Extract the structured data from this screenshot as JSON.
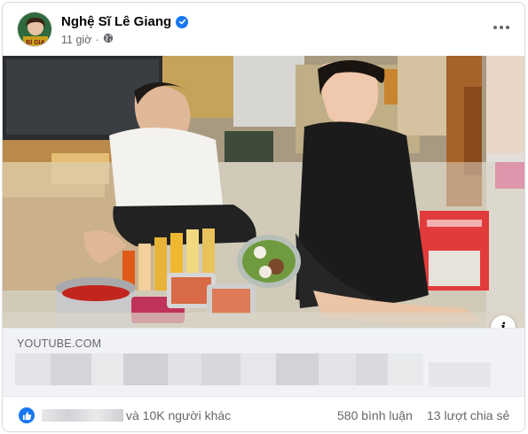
{
  "post": {
    "author_name": "Nghệ Sĩ Lê Giang",
    "timestamp": "11 giờ",
    "audience_icon": "globe-icon",
    "verified_icon": "verified-badge-icon",
    "avatar_badge_text": "BÍ GIA"
  },
  "media": {
    "info_icon_label": "i"
  },
  "link_preview": {
    "domain": "YOUTUBE.COM"
  },
  "engagement": {
    "reaction_icon": "like-icon",
    "others_text": "và 10K người khác",
    "comments_text": "580 bình luận",
    "shares_text": "13 lượt chia sẻ"
  },
  "colors": {
    "facebook_blue": "#1877f2",
    "secondary_text": "#65676b",
    "link_box_bg": "#f0f2f5"
  }
}
